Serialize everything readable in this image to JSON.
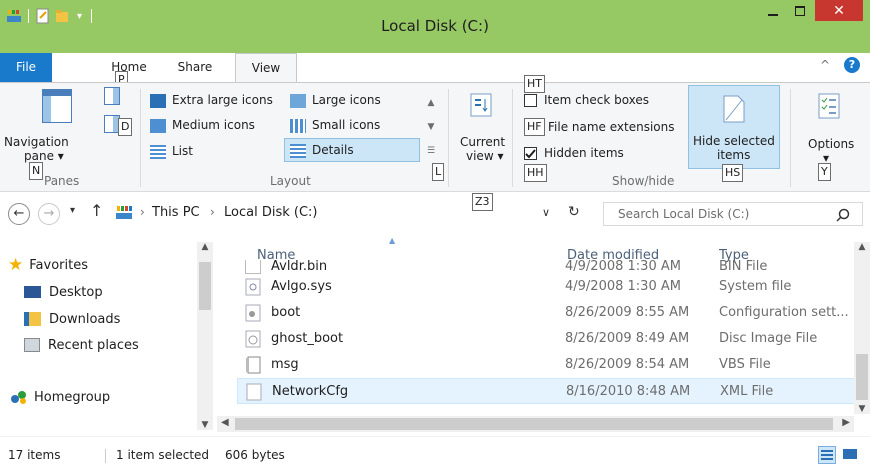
{
  "window": {
    "title": "Local Disk (C:)"
  },
  "titlebar": {
    "minimize_icon": "minimize-icon",
    "maximize_icon": "maximize-icon",
    "close_icon": "close-icon",
    "minimize": "–",
    "maximize": "□",
    "close": "✕"
  },
  "tabs": [
    {
      "label": "File"
    },
    {
      "label": "Home"
    },
    {
      "label": "Share"
    },
    {
      "label": "View"
    }
  ],
  "ribbon": {
    "collapse_glyph": "^",
    "help_glyph": "?",
    "panes": {
      "navigation_pane": "Navigation",
      "navigation_pane_2": "pane ▾",
      "group_name": "Panes",
      "keytip_p": "P",
      "keytip_d": "D",
      "keytip_n": "N"
    },
    "layout": {
      "extra_large": "Extra large icons",
      "large": "Large icons",
      "medium": "Medium icons",
      "small": "Small icons",
      "list": "List",
      "details": "Details",
      "group_name": "Layout",
      "keytip_l": "L"
    },
    "current_view": {
      "label1": "Current",
      "label2": "view ▾",
      "keytip": "Z3"
    },
    "show_hide": {
      "item_check_boxes": "Item check boxes",
      "file_name_extensions": "File name extensions",
      "hidden_items": "Hidden items",
      "hidden_items_checked": true,
      "hide_selected_1": "Hide selected",
      "hide_selected_2": "items",
      "group_name": "Show/hide",
      "keytip_ht": "HT",
      "keytip_hf": "HF",
      "keytip_hh": "HH",
      "keytip_hs": "HS"
    },
    "options": {
      "label": "Options",
      "arrow": "▾",
      "keytip": "Y"
    }
  },
  "address": {
    "back": "←",
    "forward": "→",
    "recent": "▾",
    "up": "↑",
    "path": [
      "This PC",
      "Local Disk (C:)"
    ],
    "sep": "›",
    "dropdown": "∨",
    "refresh": "↻",
    "search_placeholder": "Search Local Disk (C:)"
  },
  "nav": {
    "favorites": "Favorites",
    "desktop": "Desktop",
    "downloads": "Downloads",
    "recent_places": "Recent places",
    "homegroup": "Homegroup"
  },
  "list": {
    "columns": {
      "name": "Name",
      "date": "Date modified",
      "type": "Type"
    },
    "rows": [
      {
        "name": "Avldr.bin",
        "date": "4/9/2008 1:30 AM",
        "type": "BIN File"
      },
      {
        "name": "Avlgo.sys",
        "date": "4/9/2008 1:30 AM",
        "type": "System file"
      },
      {
        "name": "boot",
        "date": "8/26/2009 8:55 AM",
        "type": "Configuration sett..."
      },
      {
        "name": "ghost_boot",
        "date": "8/26/2009 8:49 AM",
        "type": "Disc Image File"
      },
      {
        "name": "msg",
        "date": "8/26/2009 8:54 AM",
        "type": "VBS File"
      },
      {
        "name": "NetworkCfg",
        "date": "8/16/2010 8:48 AM",
        "type": "XML File"
      }
    ]
  },
  "status": {
    "items": "17 items",
    "selection": "1 item selected",
    "size": "606 bytes"
  },
  "colors": {
    "titlebar": "#96c864",
    "file_tab": "#1979ca",
    "close": "#c7372f",
    "selection": "#cde6f7"
  }
}
